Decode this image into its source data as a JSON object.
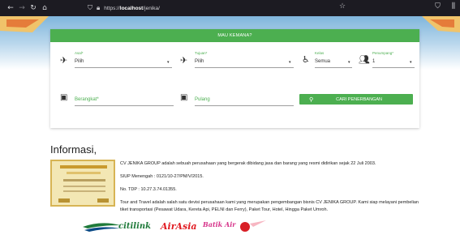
{
  "browser": {
    "url_prefix": "https://",
    "url_host": "localhost",
    "url_path": "/jenika/"
  },
  "search_card": {
    "header": "MAU KEMANA?",
    "asal": {
      "label": "Asal*",
      "value": "Pilih"
    },
    "tujuan": {
      "label": "Tujuan*",
      "value": "Pilih"
    },
    "kelas": {
      "label": "Kelas",
      "value": "Semua"
    },
    "penumpang": {
      "label": "Penumpang*",
      "value": "1"
    },
    "berangkat_placeholder": "Berangkat*",
    "pulang_placeholder": "Pulang",
    "search_button": "CARI PENERBANGAN"
  },
  "info": {
    "title": "Informasi,",
    "p1": "CV JENIKA GROUP adalah sebuah perusahaan yang bergerak dibidang jasa dan barang yang resmi didirikan sejak 22 Juli 2003.",
    "p2": "SIUP Menengah : 0121/10-27/PM/V/2015.",
    "p3": "No. TDP : 10.27.3.74.01355.",
    "p4": "Tour and Travel adalah salah satu devisi perusahaan kami yang merupakan pengembangan bisnis CV JENIKA GROUP. Kami siap melayani pembelian tiket transportasi (Pesawat Udara, Kereta Api, PELNI dan Ferry), Paket Tour, Hotel, Hingga Paket Umroh."
  },
  "logos": {
    "citilink": "citilink",
    "airasia": "AirAsia",
    "batik": "Batik Air"
  },
  "colors": {
    "accent": "#4caf50",
    "browser_bar": "#1c1b22"
  }
}
